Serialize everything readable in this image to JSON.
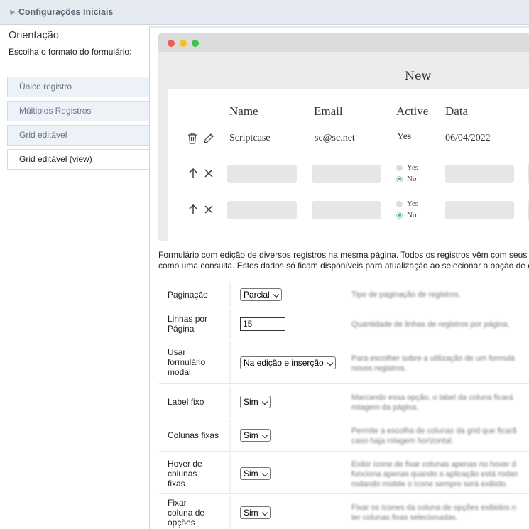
{
  "header": {
    "title": "Configurações Iniciais"
  },
  "sidebar": {
    "heading": "Orientação",
    "subtitle": "Escolha o formato do formulário:",
    "options": [
      {
        "label": "Único registro"
      },
      {
        "label": "Múltiplos Registros"
      },
      {
        "label": "Grid editável"
      },
      {
        "label": "Grid editável (view)"
      }
    ]
  },
  "preview": {
    "window_title": "New",
    "columns": [
      "Name",
      "Email",
      "Active",
      "Data"
    ],
    "record": {
      "name": "Scriptcase",
      "email": "sc@sc.net",
      "active": "Yes",
      "date": "06/04/2022"
    },
    "radio_yes": "Yes",
    "radio_no": "No"
  },
  "description": {
    "line1": "Formulário com edição de diversos registros na mesma página. Todos os registros vêm com seus",
    "line2": "como uma consulta. Estes dados só ficam disponíveis para atualização ao selecionar a opção de e"
  },
  "settings": [
    {
      "label": "Paginação",
      "type": "select",
      "value": "Parcial",
      "hint1": "Tipo de paginação de registros.",
      "hint2": ""
    },
    {
      "label": "Linhas por Página",
      "type": "input",
      "value": "15",
      "hint1": "Quantidade de linhas de registros por página.",
      "hint2": ""
    },
    {
      "label": "Usar formulário modal",
      "type": "select",
      "value": "Na edição e inserção",
      "hint1": "Para escolher sobre a utilização de um formulá",
      "hint2": "novos registros."
    },
    {
      "label": "Label fixo",
      "type": "select",
      "value": "Sim",
      "hint1": "Marcando essa opção, o label da coluna ficará",
      "hint2": "rolagem da página."
    },
    {
      "label": "Colunas fixas",
      "type": "select",
      "value": "Sim",
      "hint1": "Permite a escolha de colunas da grid que ficarã",
      "hint2": "caso haja rolagem horizontal."
    },
    {
      "label": "Hover de colunas fixas",
      "type": "select",
      "value": "Sim",
      "hint1": "Exibir ícone de fixar colunas apenas no hover d",
      "hint2": "funciona apenas quando a aplicação está rodan",
      "hint3": "rodando mobile o ícone sempre será exibido."
    },
    {
      "label": "Fixar coluna de opções",
      "type": "select",
      "value": "Sim",
      "hint1": "Fixar os ícones da coluna de opções exibidos n",
      "hint2": "ter colunas fixas selecionadas."
    }
  ],
  "icons": {
    "collapse": "triangle-collapse-icon",
    "delete": "trash-icon",
    "edit": "pencil-icon",
    "move": "arrow-up-icon",
    "remove": "close-icon"
  },
  "colors": {
    "header_bg": "#e6ebf2",
    "header_text": "#5b6675",
    "option_bg": "#edf2f8",
    "dot_red": "#ef5a52",
    "dot_yellow": "#f5bf2f",
    "dot_green": "#3fc34c",
    "radio_on": "#3bbf5a"
  }
}
